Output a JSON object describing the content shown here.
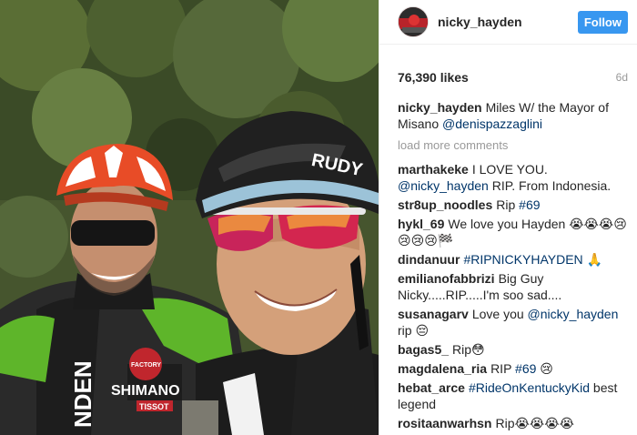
{
  "post": {
    "username": "nicky_hayden",
    "follow_label": "Follow",
    "likes": "76,390 likes",
    "age": "6d",
    "caption_user": "nicky_hayden",
    "caption_text": "Miles W/ the Mayor of Misano",
    "caption_mention": "@denispazzaglini",
    "load_more": "load more comments"
  },
  "comments": [
    {
      "user": "marthakeke",
      "text": "I LOVE YOU.",
      "mention": "@nicky_hayden",
      "after": "RIP. From Indonesia."
    },
    {
      "user": "str8up_noodles",
      "text": "Rip",
      "mention": "#69",
      "after": ""
    },
    {
      "user": "hykl_69",
      "text": "We love you Hayden 😭😭😭😢😢😢😢🏁",
      "mention": "",
      "after": ""
    },
    {
      "user": "dindanuur",
      "text": "",
      "mention": "#RIPNICKYHAYDEN",
      "after": "🙏"
    },
    {
      "user": "emilianofabbrizi",
      "text": "Big Guy Nicky.....RIP.....I'm soo sad....",
      "mention": "",
      "after": ""
    },
    {
      "user": "susanagarv",
      "text": "Love you",
      "mention": "@nicky_hayden",
      "after": "rip 😔"
    },
    {
      "user": "bagas5_",
      "text": "Rip😳",
      "mention": "",
      "after": ""
    },
    {
      "user": "magdalena_ria",
      "text": "RIP",
      "mention": "#69",
      "after": "😢"
    },
    {
      "user": "hebat_arce",
      "text": "",
      "mention": "#RideOnKentuckyKid",
      "after": "best legend"
    },
    {
      "user": "rositaanwarhsn",
      "text": "Rip😭😭😭😭",
      "mention": "",
      "after": ""
    }
  ],
  "photo_text": {
    "helmet_brand": "RUDY",
    "jersey_sponsor": "SHIMANO",
    "jersey_sponsor2": "TISSOT",
    "sleeve": "NDEN",
    "jersey_badge": "FACTORY"
  },
  "icons": {
    "avatar": "avatar-photo"
  }
}
